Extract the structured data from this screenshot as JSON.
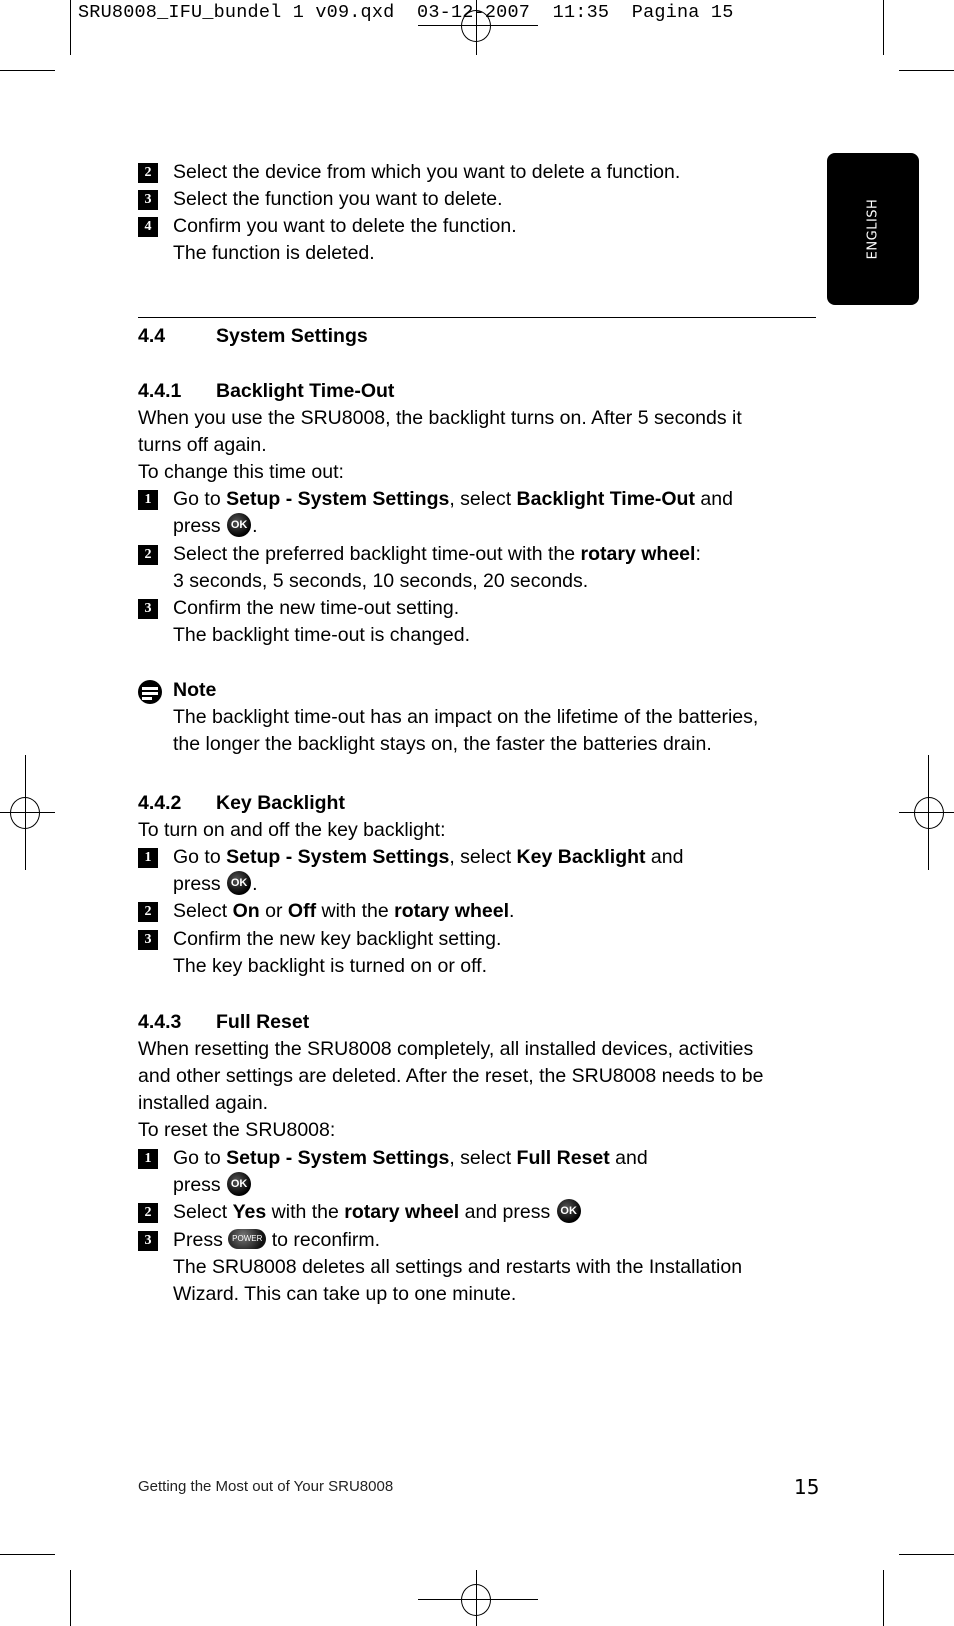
{
  "slug": "SRU8008_IFU_bundel 1 v09.qxd  03-12-2007  11:35  Pagina 15",
  "language_tab": "ENGLISH",
  "continued_steps": [
    {
      "num": "2",
      "text": "Select the device from which you want to delete a function."
    },
    {
      "num": "3",
      "text": "Select the function you want to delete."
    },
    {
      "num": "4",
      "text": "Confirm you want to delete the function."
    }
  ],
  "continued_result": "The function is deleted.",
  "section": {
    "number": "4.4",
    "title": "System Settings"
  },
  "backlight_timeout": {
    "number": "4.4.1",
    "title": "Backlight Time-Out",
    "intro_1": "When you use the SRU8008, the backlight turns on. After 5 seconds it",
    "intro_2": "turns off again.",
    "intro_3": "To change this time out:",
    "step1": {
      "num": "1",
      "pre": "Go to ",
      "b1": "Setup - System Settings",
      "mid": ", select ",
      "b2": "Backlight Time-Out",
      "post": " and",
      "line2": "press",
      "button": "OK"
    },
    "step2": {
      "num": "2",
      "pre": "Select the preferred backlight time-out with the ",
      "b1": "rotary wheel",
      "post": ":",
      "line2": "3 seconds, 5 seconds, 10 seconds, 20 seconds."
    },
    "step3": {
      "num": "3",
      "text": "Confirm the new time-out setting.",
      "result": "The backlight time-out is changed."
    },
    "note_label": "Note",
    "note_1": "The backlight time-out has an impact on the lifetime of the batteries,",
    "note_2": "the longer the backlight stays on, the faster the batteries drain."
  },
  "key_backlight": {
    "number": "4.4.2",
    "title": "Key Backlight",
    "intro": "To turn on and off the key backlight:",
    "step1": {
      "num": "1",
      "pre": "Go to ",
      "b1": "Setup - System Settings",
      "mid": ", select ",
      "b2": "Key Backlight",
      "post": " and",
      "line2": "press",
      "button": "OK"
    },
    "step2": {
      "num": "2",
      "pre": "Select ",
      "b1": "On",
      "mid": " or ",
      "b2": "Off",
      "mid2": " with the ",
      "b3": "rotary wheel",
      "post": "."
    },
    "step3": {
      "num": "3",
      "text": "Confirm the new key backlight setting.",
      "result": "The key backlight is turned on or off."
    }
  },
  "full_reset": {
    "number": "4.4.3",
    "title": "Full Reset",
    "intro_1": "When resetting the SRU8008 completely, all installed devices, activities",
    "intro_2": "and other settings are deleted. After the reset, the SRU8008 needs to be",
    "intro_3": "installed again.",
    "intro_4": "To reset the SRU8008:",
    "step1": {
      "num": "1",
      "pre": "Go to ",
      "b1": "Setup - System Settings",
      "mid": ", select ",
      "b2": "Full Reset",
      "post": " and",
      "line2": "press",
      "button": "OK"
    },
    "step2": {
      "num": "2",
      "pre": "Select ",
      "b1": "Yes",
      "mid": " with the ",
      "b2": "rotary wheel",
      "post": " and press",
      "button": "OK"
    },
    "step3": {
      "num": "3",
      "pre": "Press",
      "button": "POWER",
      "post": "to reconfirm.",
      "result_1": "The SRU8008 deletes all settings and restarts with the Installation",
      "result_2": "Wizard. This can take up to one minute."
    }
  },
  "footer": {
    "title": "Getting the Most out of Your SRU8008",
    "page": "15"
  }
}
